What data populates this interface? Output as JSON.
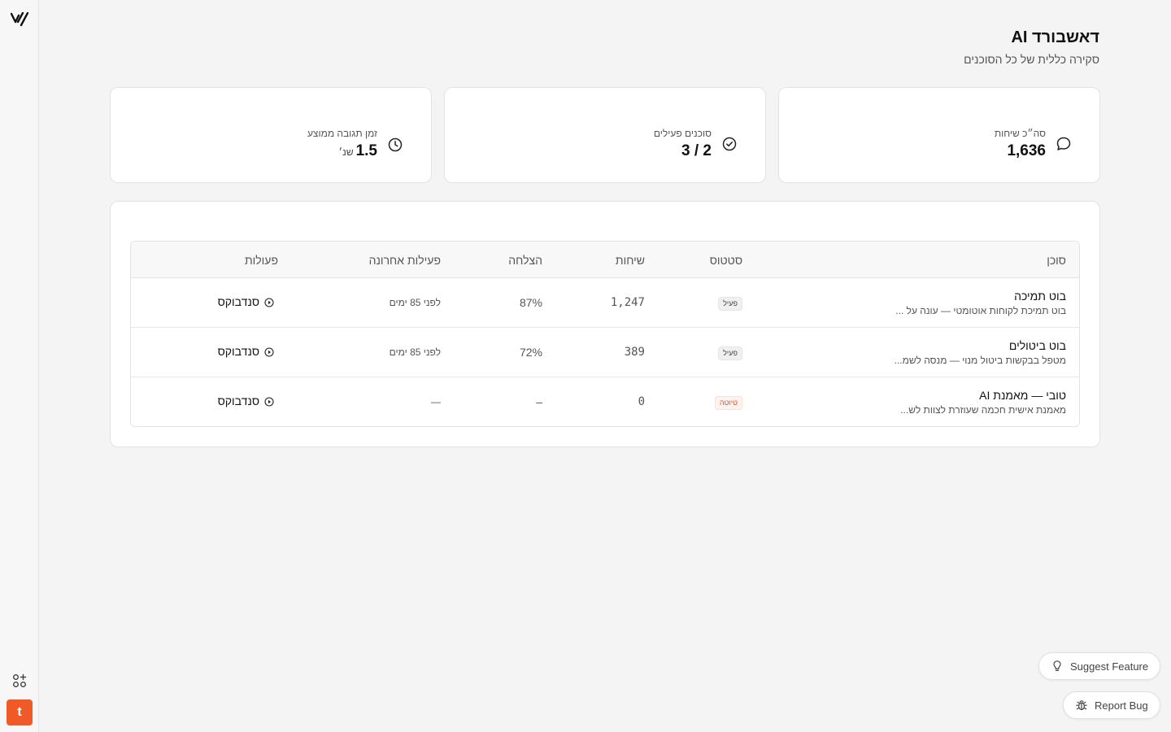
{
  "header": {
    "title": "דאשבורד AI",
    "subtitle": "סקירה כללית של כל הסוכנים"
  },
  "stats": [
    {
      "label": "סה״כ שיחות",
      "value": "1,636",
      "unit": "",
      "icon": "chat-bubble-icon"
    },
    {
      "label": "סוכנים פעילים",
      "value": "2 / 3",
      "unit": "",
      "icon": "check-circle-icon"
    },
    {
      "label": "זמן תגובה ממוצע",
      "value": "1.5",
      "unit": "שנ׳",
      "icon": "clock-icon"
    }
  ],
  "table": {
    "headers": {
      "agent": "סוכן",
      "status": "סטטוס",
      "conversations": "שיחות",
      "success": "הצלחה",
      "last_activity": "פעילות אחרונה",
      "actions": "פעולות"
    },
    "rows": [
      {
        "name": "בוט תמיכה",
        "description": "בוט תמיכת לקוחות אוטומטי — עונה על ...",
        "status": "פעיל",
        "conversations": "1,247",
        "success": "87%",
        "last_activity": "לפני 85 ימים",
        "action": "סנדבוקס"
      },
      {
        "name": "בוט ביטולים",
        "description": "מטפל בבקשות ביטול מנוי — מנסה לשמ...",
        "status": "פעיל",
        "conversations": "389",
        "success": "72%",
        "last_activity": "לפני 85 ימים",
        "action": "סנדבוקס"
      },
      {
        "name": "טובי — מאמנת AI",
        "description": "מאמנת אישית חכמה שעוזרת לצוות לש...",
        "status": "טיוטה",
        "conversations": "0",
        "success": "–",
        "last_activity": "—",
        "action": "סנדבוקס"
      }
    ]
  },
  "floating": {
    "suggest": "Suggest Feature",
    "report": "Report Bug"
  },
  "user": {
    "initial": "t"
  },
  "colors": {
    "accent": "#f05a28",
    "draft_badge": "#e04b1a"
  }
}
